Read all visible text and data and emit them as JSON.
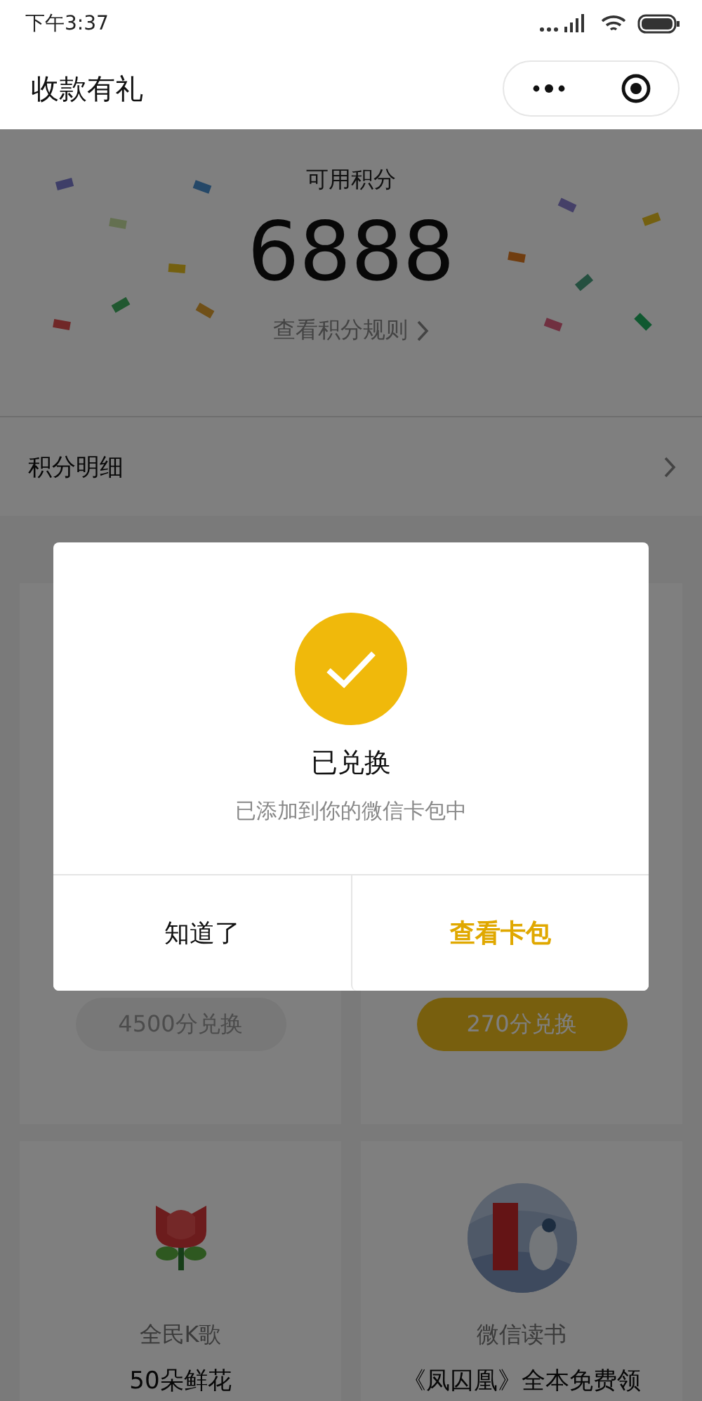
{
  "status_bar": {
    "time": "下午3:37"
  },
  "nav": {
    "title": "收款有礼"
  },
  "points": {
    "label": "可用积分",
    "value": "6888",
    "rules_link": "查看积分规则"
  },
  "detail_row": {
    "label": "积分明细"
  },
  "rewards": [
    {
      "button": "4500分兑换",
      "disabled": true
    },
    {
      "button": "270分兑换",
      "disabled": false
    },
    {
      "kind": "flower",
      "brand": "全民K歌",
      "title": "50朵鲜花"
    },
    {
      "kind": "picture",
      "brand": "微信读书",
      "title": "《凤囚凰》全本免费领"
    }
  ],
  "dialog": {
    "title": "已兑换",
    "message": "已添加到你的微信卡包中",
    "buttons": [
      {
        "label": "知道了",
        "primary": false
      },
      {
        "label": "查看卡包",
        "primary": true
      }
    ]
  }
}
